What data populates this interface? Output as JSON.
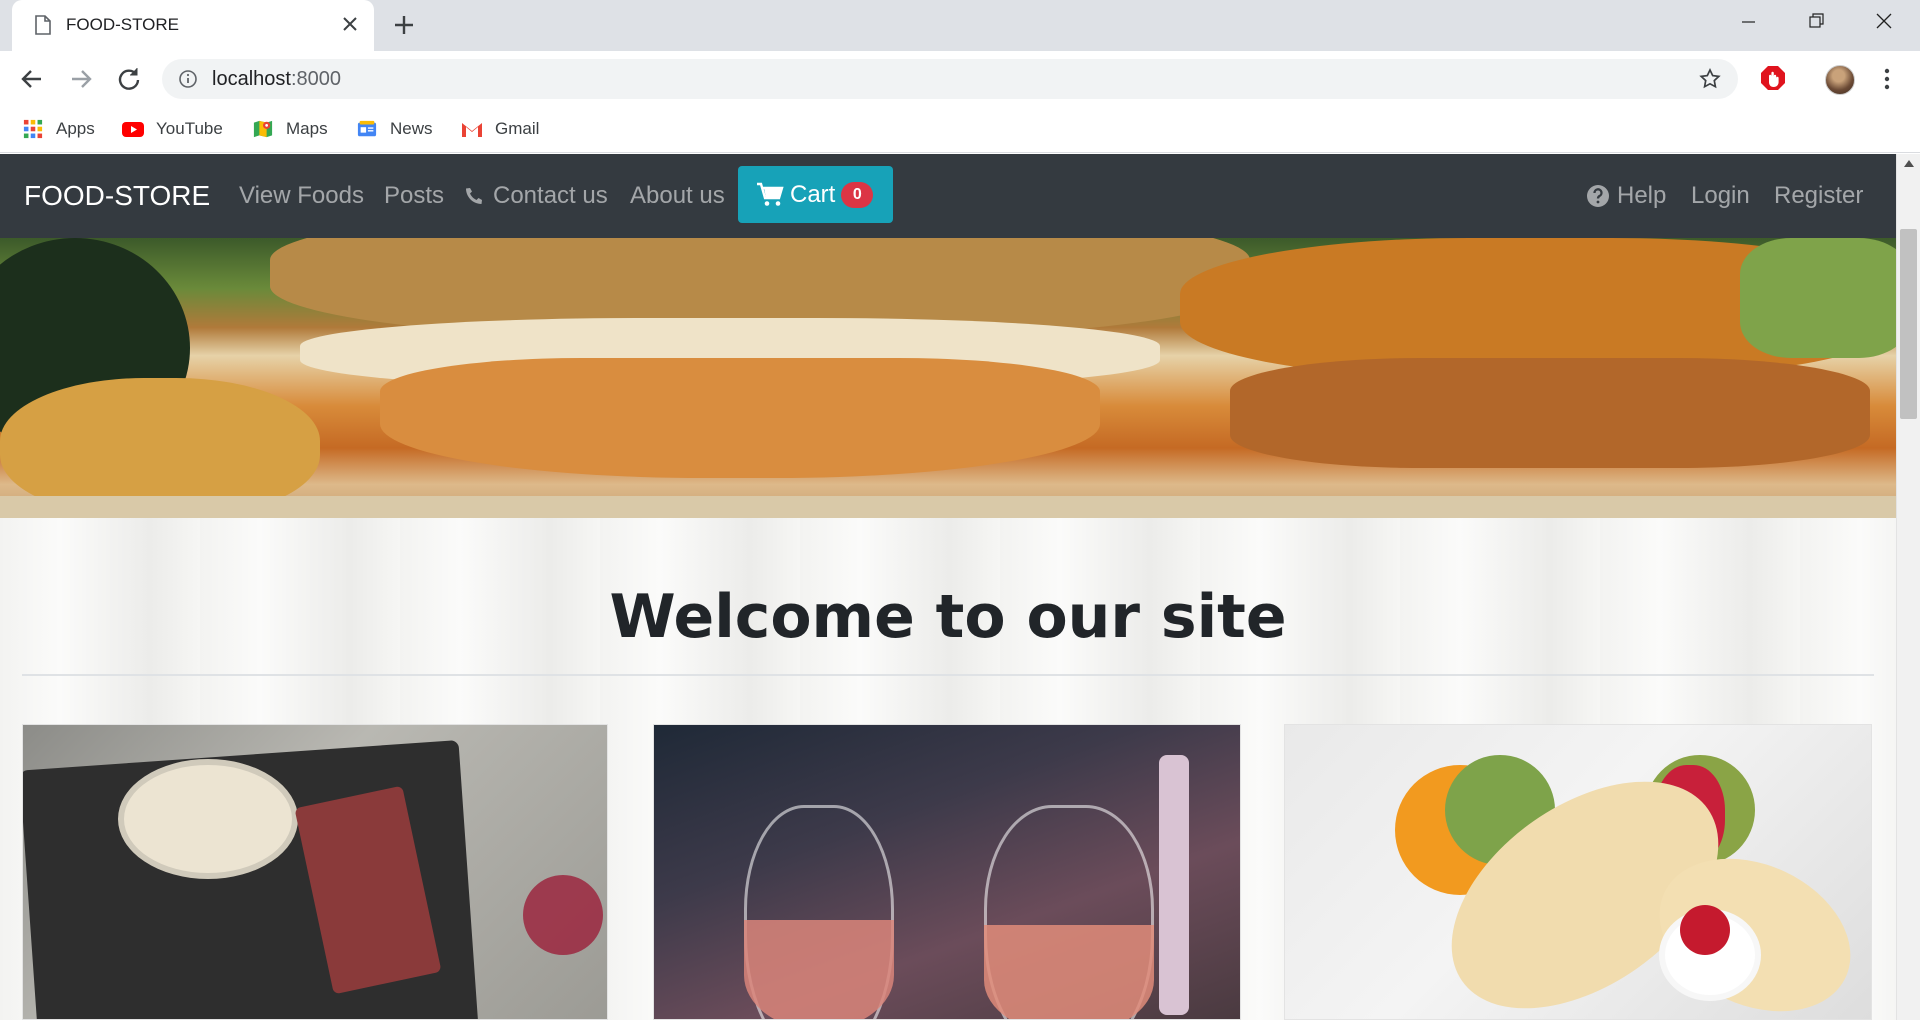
{
  "browser": {
    "tab_title": "FOOD-STORE",
    "url_host": "localhost",
    "url_port": ":8000",
    "bookmarks": [
      {
        "label": "Apps",
        "icon": "apps-grid-icon"
      },
      {
        "label": "YouTube",
        "icon": "youtube-icon"
      },
      {
        "label": "Maps",
        "icon": "maps-icon"
      },
      {
        "label": "News",
        "icon": "news-icon"
      },
      {
        "label": "Gmail",
        "icon": "gmail-icon"
      }
    ]
  },
  "navbar": {
    "brand": "FOOD-STORE",
    "links": {
      "view_foods": "View Foods",
      "posts": "Posts",
      "contact": "Contact us",
      "about": "About us",
      "help": "Help",
      "login": "Login",
      "register": "Register"
    },
    "cart": {
      "label": "Cart",
      "count": "0"
    }
  },
  "main": {
    "welcome_heading": "Welcome to our site"
  },
  "colors": {
    "navbar_bg": "#343a40",
    "cart_button": "#17a2b8",
    "badge": "#dc3545"
  }
}
